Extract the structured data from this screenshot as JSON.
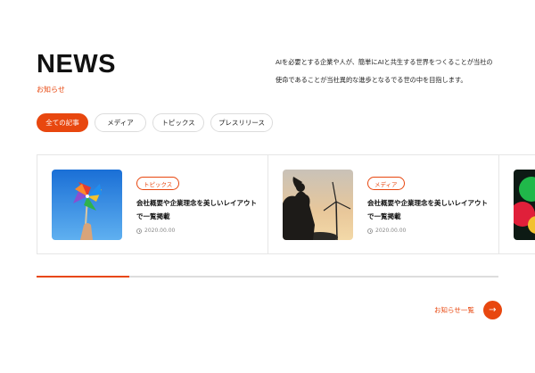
{
  "header": {
    "title": "NEWS",
    "subtitle": "お知らせ",
    "lead": "AIを必要とする企業や人が、簡単にAIと共生する世界をつくることが当社の使命であることが当社異的な進歩となるでる世の中を目指します。"
  },
  "filters": [
    {
      "label": "全ての記事",
      "active": true
    },
    {
      "label": "メディア",
      "active": false
    },
    {
      "label": "トピックス",
      "active": false
    },
    {
      "label": "プレスリリース",
      "active": false
    }
  ],
  "cards": [
    {
      "tag": "トピックス",
      "title": "会社概要や企業理念を美しいレイアウトで一覧掲載",
      "date": "2020.00.00",
      "image": "pinwheel-photo"
    },
    {
      "tag": "メディア",
      "title": "会社概要や企業理念を美しいレイアウトで一覧掲載",
      "date": "2020.00.00",
      "image": "wind-turbine-silhouette-photo"
    },
    {
      "tag": "",
      "title": "",
      "date": "",
      "image": "colorful-partial-photo"
    }
  ],
  "progress": {
    "fraction": 0.2
  },
  "more": {
    "label": "お知らせ一覧",
    "icon": "arrow-right-icon"
  },
  "colors": {
    "accent": "#e8470f",
    "border": "#e6e6e6"
  }
}
